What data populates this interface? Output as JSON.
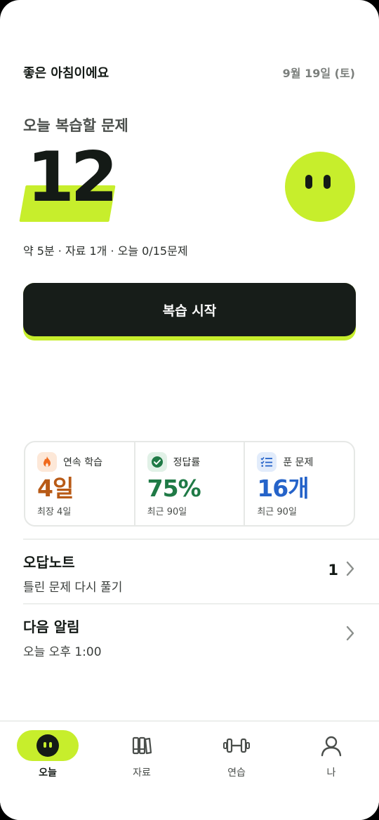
{
  "header": {
    "greeting": "좋은 아침이에요",
    "date": "9월 19일 (토)"
  },
  "review": {
    "label": "오늘 복습할 문제",
    "count": "12",
    "meta": "약 5분 · 자료 1개 · 오늘 0/15문제",
    "start_label": "복습 시작"
  },
  "stats": [
    {
      "title": "연속 학습",
      "value": "4일",
      "sub": "최장 4일",
      "color": "#b85a16",
      "icon": "flame-icon"
    },
    {
      "title": "정답률",
      "value": "75%",
      "sub": "최근 90일",
      "color": "#1f7a46",
      "icon": "check-circle-icon"
    },
    {
      "title": "푼 문제",
      "value": "16개",
      "sub": "최근 90일",
      "color": "#2563c9",
      "icon": "checklist-icon"
    }
  ],
  "rows": {
    "wrong_note": {
      "title": "오답노트",
      "sub": "틀린 문제 다시 풀기",
      "count": "1"
    },
    "next_alarm": {
      "title": "다음 알림",
      "sub": "오늘 오후 1:00"
    }
  },
  "tabs": [
    {
      "label": "오늘",
      "icon": "face-icon",
      "active": true
    },
    {
      "label": "자료",
      "icon": "books-icon",
      "active": false
    },
    {
      "label": "연습",
      "icon": "dumbbell-icon",
      "active": false
    },
    {
      "label": "나",
      "icon": "person-icon",
      "active": false
    }
  ],
  "colors": {
    "accent": "#c7ee2c",
    "dark": "#171d19"
  }
}
